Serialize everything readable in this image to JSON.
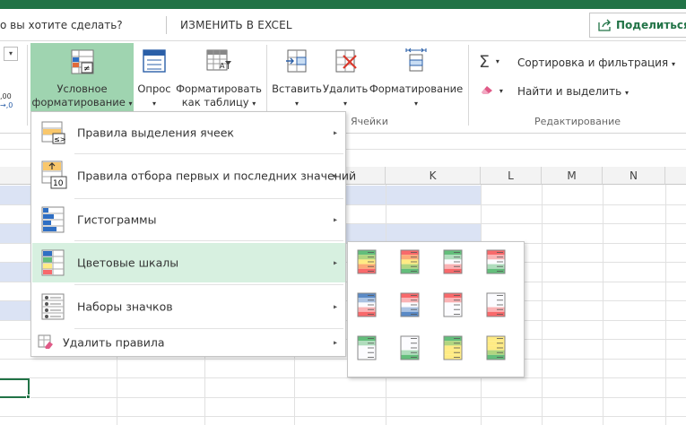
{
  "tellme": {
    "text": "о вы хотите сделать?",
    "edit_in_excel": "ИЗМЕНИТЬ В EXCEL",
    "share": "Поделиться"
  },
  "ribbon": {
    "num_format_small": ",00\n→,0",
    "cond_format": {
      "line1": "Условное",
      "line2": "форматирование"
    },
    "survey": {
      "label": "Опрос"
    },
    "format_table": {
      "line1": "Форматировать",
      "line2": "как таблицу"
    },
    "insert": {
      "label": "Вставить"
    },
    "delete": {
      "label": "Удалить"
    },
    "format": {
      "label": "Форматирование"
    },
    "cells_group": "Ячейки",
    "editing": {
      "sort_filter": "Сортировка и фильтрация",
      "find_select": "Найти и выделить",
      "group_label": "Редактирование"
    }
  },
  "columns": [
    "K",
    "L",
    "M",
    "N"
  ],
  "menu": {
    "items": [
      {
        "label": "Правила выделения ячеек",
        "icon": "highlight-rules-icon"
      },
      {
        "label": "Правила отбора первых и последних значений",
        "icon": "top-bottom-rules-icon"
      },
      {
        "label": "Гистограммы",
        "icon": "data-bars-icon"
      },
      {
        "label": "Цветовые шкалы",
        "icon": "color-scales-icon"
      },
      {
        "label": "Наборы значков",
        "icon": "icon-sets-icon"
      },
      {
        "label": "Удалить правила",
        "icon": "clear-rules-icon"
      }
    ],
    "top_bottom_badge": "10"
  },
  "colors": {
    "brand": "#217346",
    "active_bg": "#d7f0e0",
    "cf_button_bg": "#9fd4b0",
    "band": "#dbe3f4"
  },
  "color_scales": [
    [
      "#63be7b",
      "#ffeb84",
      "#f8696b"
    ],
    [
      "#f8696b",
      "#ffeb84",
      "#63be7b"
    ],
    [
      "#63be7b",
      "#fcfcff",
      "#f8696b"
    ],
    [
      "#f8696b",
      "#fcfcff",
      "#63be7b"
    ],
    [
      "#5a8ac6",
      "#fcfcff",
      "#f8696b"
    ],
    [
      "#f8696b",
      "#fcfcff",
      "#5a8ac6"
    ],
    [
      "#f8696b",
      "#fcfcff",
      "#fcfcff"
    ],
    [
      "#fcfcff",
      "#fcfcff",
      "#f8696b"
    ],
    [
      "#63be7b",
      "#fcfcff",
      "#fcfcff"
    ],
    [
      "#fcfcff",
      "#fcfcff",
      "#63be7b"
    ],
    [
      "#63be7b",
      "#ffeb84",
      "#ffeb84"
    ],
    [
      "#ffeb84",
      "#ffeb84",
      "#63be7b"
    ]
  ]
}
